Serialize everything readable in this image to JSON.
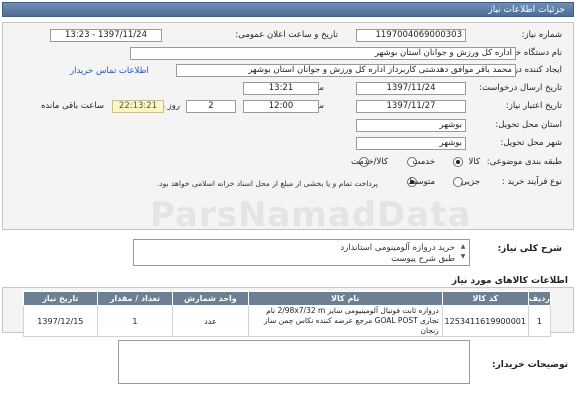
{
  "header": {
    "title": "جزئیات اطلاعات نیاز"
  },
  "form": {
    "need_number_label": "شماره نیاز:",
    "need_number": "1197004069000303",
    "announce_label": "تاریخ و ساعت اعلان عمومی:",
    "announce_value": "1397/11/24 - 13:23",
    "buyer_org_label": "نام دستگاه خریدار:",
    "buyer_org": "اداره کل ورزش و جوانان استان بوشهر",
    "requester_label": "ایجاد کننده درخواست:",
    "requester": "محمد باقر موافق دهدشتی کاربرداز اداره کل ورزش و جوانان استان بوشهر",
    "contact_link": "اطلاعات تماس خریدار",
    "send_date_label": "تاریخ ارسال درخواست:",
    "send_date": "1397/11/24",
    "send_time_label": "ساعت",
    "send_time": "13:21",
    "deadline_label": "تاریخ اعتبار نیاز:",
    "deadline_date": "1397/11/27",
    "deadline_time_label": "ساعت",
    "deadline_time": "12:00",
    "days_value": "2",
    "days_label": "روز و",
    "remaining_time": "22:13:21",
    "remaining_label": "ساعت باقی مانده",
    "province_label": "استان محل تحویل:",
    "province": "بوشهر",
    "city_label": "شهر محل تحویل:",
    "city": "بوشهر",
    "category_label": "طبقه بندی موضوعی:",
    "category_options": [
      "کالا",
      "خدمت",
      "کالا/خدمت"
    ],
    "category_selected": "کالا",
    "process_label": "نوع فرآیند خرید :",
    "process_options": [
      "جزیی",
      "متوسط"
    ],
    "process_selected": "متوسط",
    "process_note": "پرداخت تمام و یا بخشی از مبلغ از محل اسناد خزانه اسلامی خواهد بود."
  },
  "description": {
    "label": "شرح کلی نیاز:",
    "lines": [
      "خرید دروازه آلومینومی استاندارد",
      "طبق شرح پیوست"
    ]
  },
  "goods": {
    "section_title": "اطلاعات کالاهای مورد نیاز",
    "columns": [
      "ردیف",
      "کد کالا",
      "نام کالا",
      "واحد شمارش",
      "تعداد / مقدار",
      "تاریخ نیاز"
    ],
    "rows": [
      {
        "row": "1",
        "code": "1253411619900001",
        "name": "دروازه ثابت فوتبال آلومینیومی سایز 2/98x7/32 m نام تجاری GOAL POST مرجع عرضه کننده نکاس چمن ساز زنجان",
        "unit": "عدد",
        "qty": "1",
        "date": "1397/12/15"
      }
    ]
  },
  "notes": {
    "label": "توضیحات خریدار:",
    "value": ""
  },
  "watermark": {
    "text": "ParsNamadData"
  }
}
